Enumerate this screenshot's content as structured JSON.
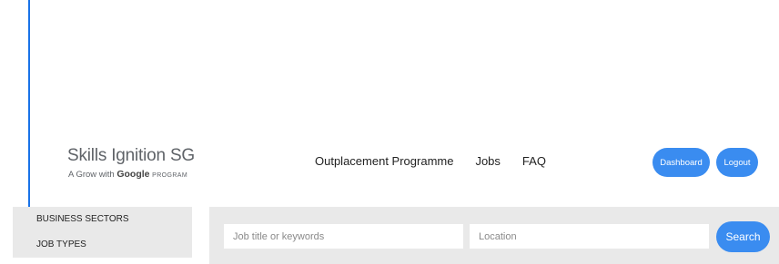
{
  "header": {
    "logo": {
      "title": "Skills Ignition SG",
      "sub_prefix": "A Grow with",
      "sub_brand": "Google",
      "sub_suffix": "PROGRAM"
    },
    "nav": [
      {
        "label": "Outplacement Programme"
      },
      {
        "label": "Jobs"
      },
      {
        "label": "FAQ"
      }
    ],
    "buttons": {
      "dashboard": "Dashboard",
      "logout": "Logout"
    }
  },
  "sidebar": {
    "items": [
      {
        "label": "BUSINESS SECTORS"
      },
      {
        "label": "JOB TYPES"
      }
    ]
  },
  "search": {
    "keywords_placeholder": "Job title or keywords",
    "location_placeholder": "Location",
    "button_label": "Search"
  },
  "colors": {
    "accent": "#3a8cf0",
    "panel": "#e9e9e9",
    "annotation_arrow": "#1a73e8"
  }
}
